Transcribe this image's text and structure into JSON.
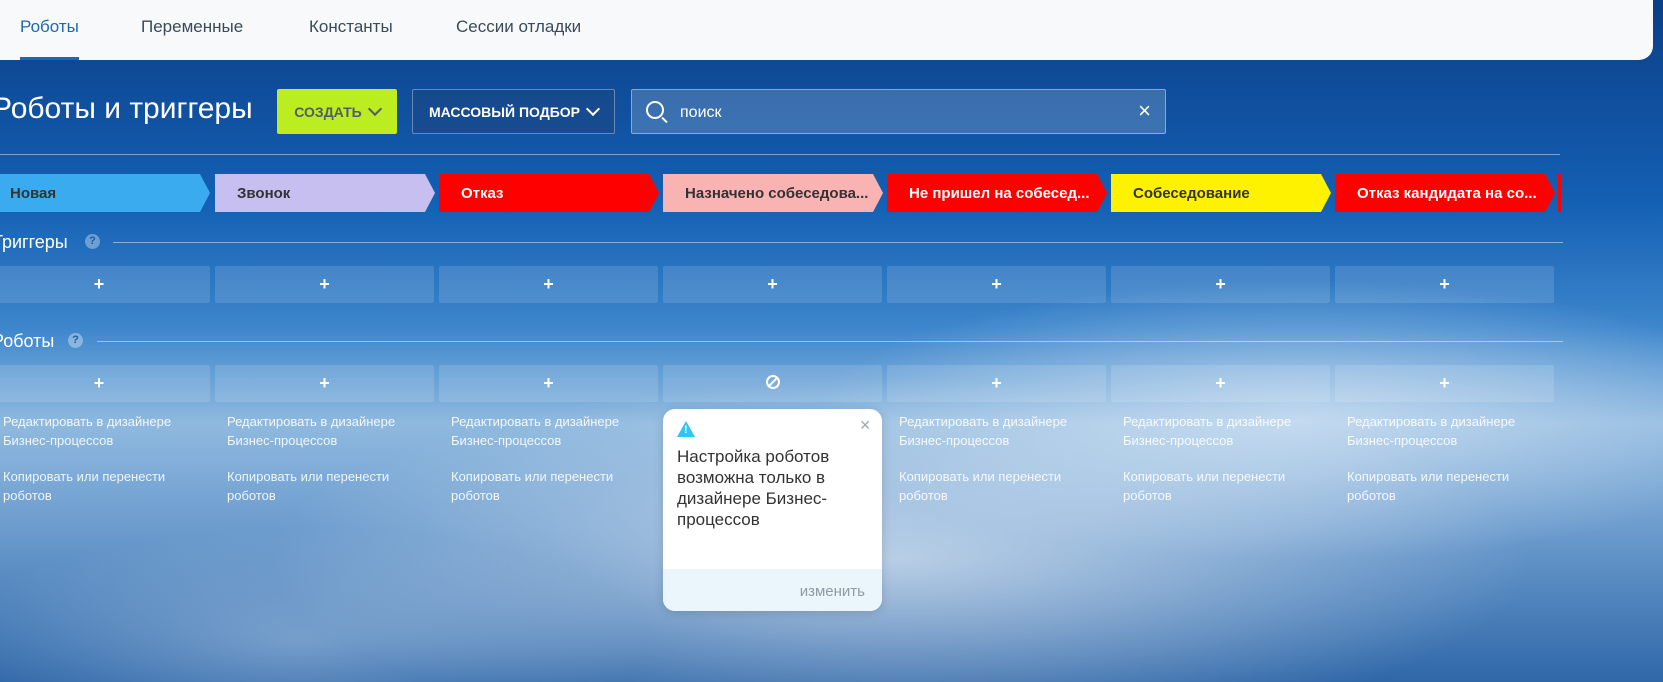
{
  "tabs": [
    "Роботы",
    "Переменные",
    "Константы",
    "Сессии отладки"
  ],
  "header": {
    "title": "Роботы и триггеры",
    "create_label": "СОЗДАТЬ",
    "mass_label": "МАССОВЫЙ ПОДБОР",
    "search_placeholder": "поиск"
  },
  "stages": [
    {
      "label": "Новая",
      "color": "#3babef",
      "text_color": "#333333"
    },
    {
      "label": "Звонок",
      "color": "#c7bff0",
      "text_color": "#333333"
    },
    {
      "label": "Отказ",
      "color": "#ff0000",
      "text_color": "#ffffff"
    },
    {
      "label": "Назначено собеседова...",
      "color": "#f9b3b3",
      "text_color": "#333333"
    },
    {
      "label": "Не пришел на собесед...",
      "color": "#ff0000",
      "text_color": "#ffffff"
    },
    {
      "label": "Собеседование",
      "color": "#fff200",
      "text_color": "#333333"
    },
    {
      "label": "Отказ кандидата на со...",
      "color": "#ff0000",
      "text_color": "#ffffff"
    }
  ],
  "triggers_title": "Триггеры",
  "robots_title": "Роботы",
  "help_icon": "?",
  "add_icon": "+",
  "links": {
    "edit": "Редактировать в дизайнере Бизнес-процессов",
    "copy": "Копировать или перенести роботов"
  },
  "popup": {
    "text": "Настройка роботов возможна только в дизайнере Бизнес-процессов",
    "change": "изменить"
  }
}
